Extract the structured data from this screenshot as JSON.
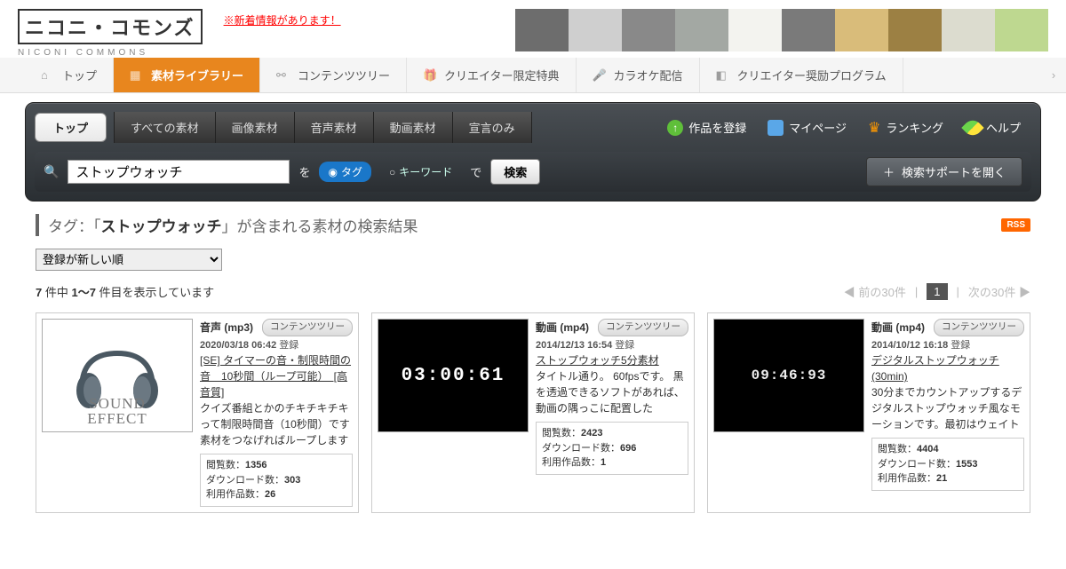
{
  "header": {
    "logo_line1": "ニコニ・コモンズ",
    "logo_line2": "NICONI COMMONS",
    "new_info": "※新着情報があります！"
  },
  "mainnav": {
    "items": [
      {
        "label": "トップ"
      },
      {
        "label": "素材ライブラリー",
        "active": true
      },
      {
        "label": "コンテンツツリー"
      },
      {
        "label": "クリエイター限定特典"
      },
      {
        "label": "カラオケ配信"
      },
      {
        "label": "クリエイター奨励プログラム"
      }
    ]
  },
  "darkpanel": {
    "toptab": "トップ",
    "tabs": [
      "すべての素材",
      "画像素材",
      "音声素材",
      "動画素材",
      "宣言のみ"
    ],
    "tools": {
      "register": "作品を登録",
      "mypage": "マイページ",
      "ranking": "ランキング",
      "help": "ヘルプ"
    },
    "search": {
      "value": "ストップウォッチ",
      "wo": "を",
      "radio_tag": "タグ",
      "radio_keyword": "キーワード",
      "de": "で",
      "go": "検索",
      "support": "検索サポートを開く"
    }
  },
  "results": {
    "heading_prefix": "タグ：「",
    "heading_tag": "ストップウォッチ",
    "heading_suffix": "」が含まれる素材の検索結果",
    "rss": "RSS",
    "sort_selected": "登録が新しい順",
    "count_line_a": "7",
    "count_line_b": " 件中 ",
    "count_line_c": "1〜7",
    "count_line_d": " 件目を表示しています",
    "prev": "前の30件",
    "page": "1",
    "next": "次の30件"
  },
  "cards": [
    {
      "type": "音声 (mp3)",
      "ct": "コンテンツツリー",
      "date": "2020/03/18 06:42",
      "reg": " 登録",
      "title": "[SE]  タイマーの音・制限時間の音　10秒間（ループ可能）　[高音質]",
      "desc": "クイズ番組とかのチキチキチキって制限時間音（10秒間）です 素材をつなげればループします",
      "thumb_kind": "se",
      "thumb_text1": "SOUND",
      "thumb_text2": "EFFECT",
      "stats": {
        "views_l": "閲覧数：",
        "views": "1356",
        "dl_l": "ダウンロード数：",
        "dl": "303",
        "use_l": "利用作品数：",
        "use": "26"
      }
    },
    {
      "type": "動画 (mp4)",
      "ct": "コンテンツツリー",
      "date": "2014/12/13 16:54",
      "reg": " 登録",
      "title": "ストップウォッチ5分素材",
      "desc": "タイトル通り。 60fpsです。 黒を透過できるソフトがあれば、動画の隅っこに配置した",
      "thumb_kind": "black_big",
      "thumb_text1": "03:00:61",
      "stats": {
        "views_l": "閲覧数：",
        "views": "2423",
        "dl_l": "ダウンロード数：",
        "dl": "696",
        "use_l": "利用作品数：",
        "use": "1"
      }
    },
    {
      "type": "動画 (mp4)",
      "ct": "コンテンツツリー",
      "date": "2014/10/12 16:18",
      "reg": " 登録",
      "title": "デジタルストップウォッチ(30min)",
      "desc": "30分までカウントアップするデジタルストップウォッチ風なモーションです。最初はウェイト",
      "thumb_kind": "black_digital",
      "thumb_text1": "09:46:93",
      "stats": {
        "views_l": "閲覧数：",
        "views": "4404",
        "dl_l": "ダウンロード数：",
        "dl": "1553",
        "use_l": "利用作品数：",
        "use": "21"
      }
    }
  ],
  "swatches": [
    "#6d6d6d",
    "#cfcfcf",
    "#898989",
    "#a3a8a3",
    "#f3f3ef",
    "#7a7a7a",
    "#d9bc7a",
    "#9c8043",
    "#dcdccf",
    "#bed890"
  ]
}
